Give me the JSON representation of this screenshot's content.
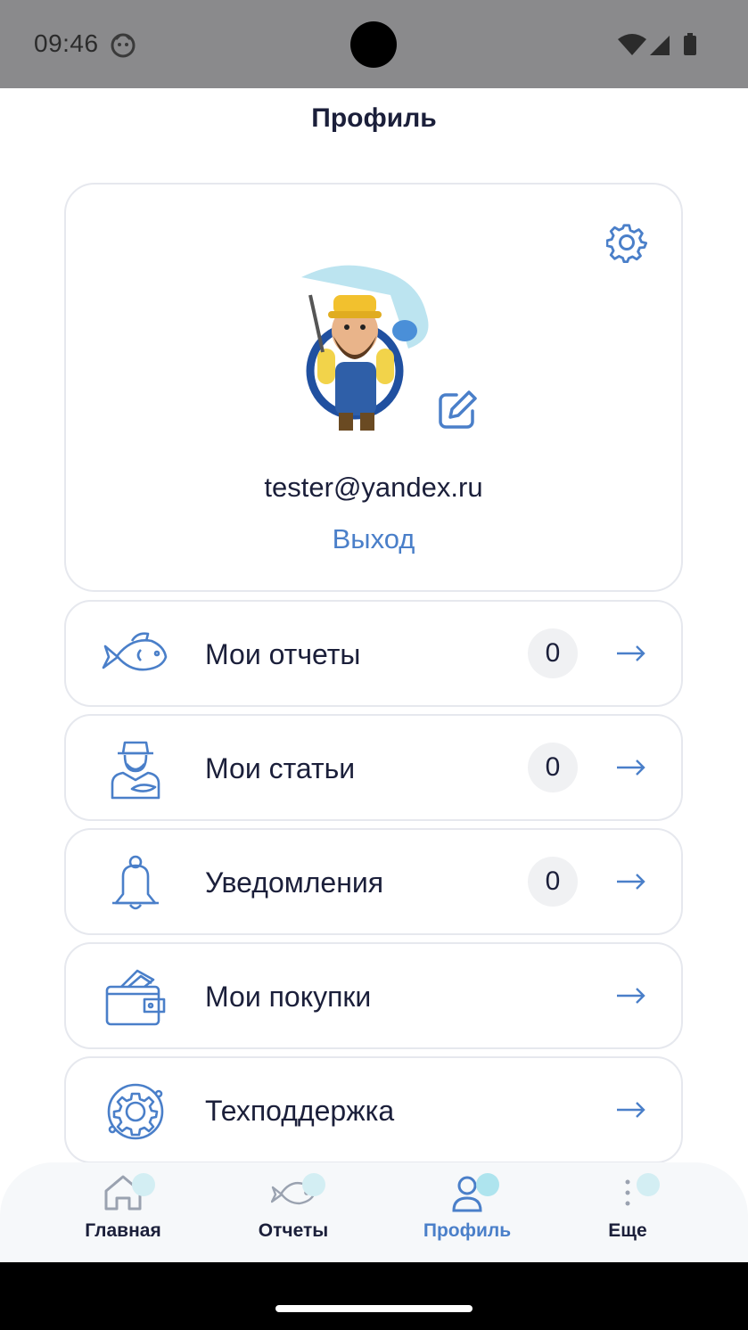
{
  "status_bar": {
    "time": "09:46",
    "icons": [
      "app-face-icon",
      "wifi-icon",
      "signal-icon",
      "battery-icon"
    ]
  },
  "header": {
    "title": "Профиль"
  },
  "profile": {
    "email": "tester@yandex.ru",
    "logout_label": "Выход",
    "accent_color": "#4a7fc9"
  },
  "menu": [
    {
      "icon": "fish-icon",
      "label": "Мои отчеты",
      "count": "0"
    },
    {
      "icon": "fisherman-icon",
      "label": "Мои статьи",
      "count": "0"
    },
    {
      "icon": "bell-icon",
      "label": "Уведомления",
      "count": "0"
    },
    {
      "icon": "wallet-icon",
      "label": "Мои покупки"
    },
    {
      "icon": "support-gear-icon",
      "label": "Техподдержка"
    }
  ],
  "bottom_nav": [
    {
      "icon": "home-icon",
      "label": "Главная",
      "active": false
    },
    {
      "icon": "fish-icon",
      "label": "Отчеты",
      "active": false
    },
    {
      "icon": "user-icon",
      "label": "Профиль",
      "active": true
    },
    {
      "icon": "more-vertical-icon",
      "label": "Еще",
      "active": false
    }
  ]
}
